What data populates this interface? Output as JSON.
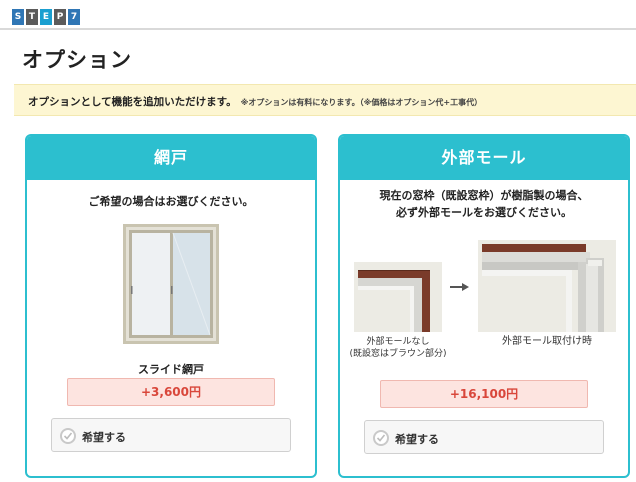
{
  "step": {
    "letters": [
      "S",
      "T",
      "E",
      "P",
      "7"
    ]
  },
  "page": {
    "title": "オプション"
  },
  "notice": {
    "main": "オプションとして機能を追加いただけます。",
    "sub": "※オプションは有料になります。（※価格はオプション代+工事代）"
  },
  "options": {
    "screen": {
      "title": "網戸",
      "description": "ご希望の場合はお選びください。",
      "product_name": "スライド網戸",
      "price": "+3,600円",
      "checkbox_label": "希望する"
    },
    "molding": {
      "title": "外部モール",
      "description_line1": "現在の窓枠（既設窓枠）が樹脂製の場合、",
      "description_line2": "必ず外部モールをお選びください。",
      "before_caption_line1": "外部モールなし",
      "before_caption_line2": "(既設窓はブラウン部分)",
      "after_caption": "外部モール取付け時",
      "price": "+16,100円",
      "checkbox_label": "希望する"
    }
  },
  "colors": {
    "accent": "#2cbfcf",
    "price_text": "#d9473b",
    "notice_bg": "#fdf6d2"
  }
}
